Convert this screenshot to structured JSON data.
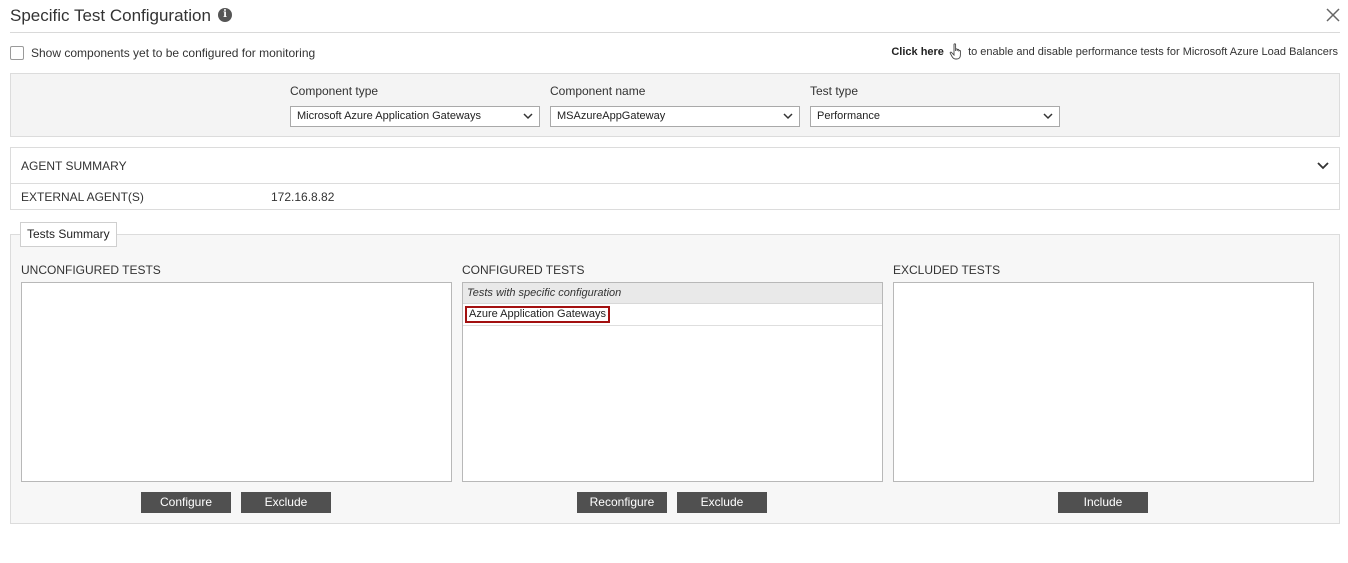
{
  "dialog": {
    "title": "Specific Test Configuration",
    "info_icon": "info-icon",
    "close_icon": "close-icon"
  },
  "options": {
    "show_components_label": "Show components yet to be configured for monitoring",
    "show_components_checked": false,
    "click_here_label": "Click here",
    "click_here_suffix": "to enable and disable performance tests for Microsoft Azure Load Balancers",
    "hand_icon": "pointer-hand-icon"
  },
  "filters": {
    "component_type_label": "Component type",
    "component_type_value": "Microsoft Azure Application Gateways",
    "component_name_label": "Component name",
    "component_name_value": "MSAzureAppGateway",
    "test_type_label": "Test type",
    "test_type_value": "Performance"
  },
  "agent_summary": {
    "title": "AGENT SUMMARY",
    "external_label": "EXTERNAL AGENT(S)",
    "external_value": "172.16.8.82"
  },
  "tests_summary": {
    "tab_label": "Tests Summary",
    "unconfigured": {
      "label": "UNCONFIGURED TESTS",
      "items": [],
      "configure_button": "Configure",
      "exclude_button": "Exclude"
    },
    "configured": {
      "label": "CONFIGURED TESTS",
      "group_header": "Tests with specific configuration",
      "items": [
        "Azure Application Gateways"
      ],
      "reconfigure_button": "Reconfigure",
      "exclude_button": "Exclude"
    },
    "excluded": {
      "label": "EXCLUDED TESTS",
      "items": [],
      "include_button": "Include"
    }
  },
  "colors": {
    "button_bg": "#505050",
    "selected_outline": "#a31010",
    "panel_bg": "#f4f4f4"
  }
}
